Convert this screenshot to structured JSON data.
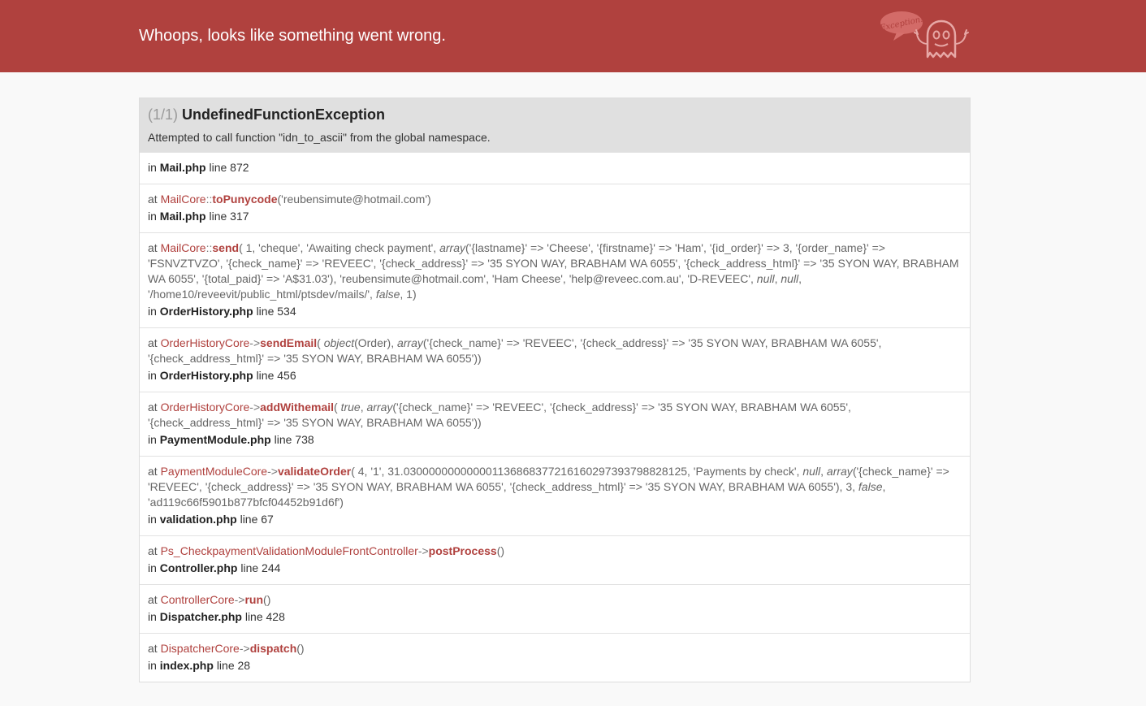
{
  "header": {
    "title": "Whoops, looks like something went wrong.",
    "logo_text": "Exception!"
  },
  "exception": {
    "count": "(1/1)",
    "class": "UndefinedFunctionException",
    "message": "Attempted to call function \"idn_to_ascii\" from the global namespace."
  },
  "frames": [
    {
      "in_label": "in",
      "file": "Mail.php",
      "line_label": "line 872"
    },
    {
      "at_label": "at",
      "class": "MailCore",
      "operator": "::",
      "function": "toPunycode",
      "args": "('reubensimute@hotmail.com')",
      "in_label": "in",
      "file": "Mail.php",
      "line_label": "line 317"
    },
    {
      "at_label": "at",
      "class": "MailCore",
      "operator": "::",
      "function": "send",
      "args_parts": [
        "( 1, 'cheque', 'Awaiting check payment', ",
        "array",
        "('{lastname}' => 'Cheese', '{firstname}' => 'Ham', '{id_order}' => 3, '{order_name}' => 'FSNVZTVZO', '{check_name}' => 'REVEEC', '{check_address}' => '35 SYON WAY, BRABHAM WA 6055', '{check_address_html}' => '35 SYON WAY, BRABHAM WA 6055', '{total_paid}' => 'A$31.03'), 'reubensimute@hotmail.com', 'Ham Cheese', 'help@reveec.com.au', 'D-REVEEC', ",
        "null",
        ", ",
        "null",
        ", '/home10/reveevit/public_html/ptsdev/mails/', ",
        "false",
        ", 1)"
      ],
      "in_label": "in",
      "file": "OrderHistory.php",
      "line_label": "line 534"
    },
    {
      "at_label": "at",
      "class": "OrderHistoryCore",
      "operator": "->",
      "function": "sendEmail",
      "args_parts": [
        "( ",
        "object",
        "(Order), ",
        "array",
        "('{check_name}' => 'REVEEC', '{check_address}' => '35 SYON WAY, BRABHAM WA 6055', '{check_address_html}' => '35 SYON WAY, BRABHAM WA 6055'))"
      ],
      "in_label": "in",
      "file": "OrderHistory.php",
      "line_label": "line 456"
    },
    {
      "at_label": "at",
      "class": "OrderHistoryCore",
      "operator": "->",
      "function": "addWithemail",
      "args_parts": [
        "( ",
        "true",
        ", ",
        "array",
        "('{check_name}' => 'REVEEC', '{check_address}' => '35 SYON WAY, BRABHAM WA 6055', '{check_address_html}' => '35 SYON WAY, BRABHAM WA 6055'))"
      ],
      "in_label": "in",
      "file": "PaymentModule.php",
      "line_label": "line 738"
    },
    {
      "at_label": "at",
      "class": "PaymentModuleCore",
      "operator": "->",
      "function": "validateOrder",
      "args_parts": [
        "( 4, '1', 31.030000000000001136868377216160297393798828125, 'Payments by check', ",
        "null",
        ", ",
        "array",
        "('{check_name}' => 'REVEEC', '{check_address}' => '35 SYON WAY, BRABHAM WA 6055', '{check_address_html}' => '35 SYON WAY, BRABHAM WA 6055'), 3, ",
        "false",
        ", 'ad119c66f5901b877bfcf04452b91d6f')"
      ],
      "in_label": "in",
      "file": "validation.php",
      "line_label": "line 67"
    },
    {
      "at_label": "at",
      "class": "Ps_CheckpaymentValidationModuleFrontController",
      "operator": "->",
      "function": "postProcess",
      "args": "()",
      "in_label": "in",
      "file": "Controller.php",
      "line_label": "line 244"
    },
    {
      "at_label": "at",
      "class": "ControllerCore",
      "operator": "->",
      "function": "run",
      "args": "()",
      "in_label": "in",
      "file": "Dispatcher.php",
      "line_label": "line 428"
    },
    {
      "at_label": "at",
      "class": "DispatcherCore",
      "operator": "->",
      "function": "dispatch",
      "args": "()",
      "in_label": "in",
      "file": "index.php",
      "line_label": "line 28"
    }
  ],
  "colors": {
    "header_bg": "#b0413e",
    "accent": "#b0413e",
    "page_bg": "#f9f9f9",
    "exception_head_bg": "#e0e0e0"
  }
}
